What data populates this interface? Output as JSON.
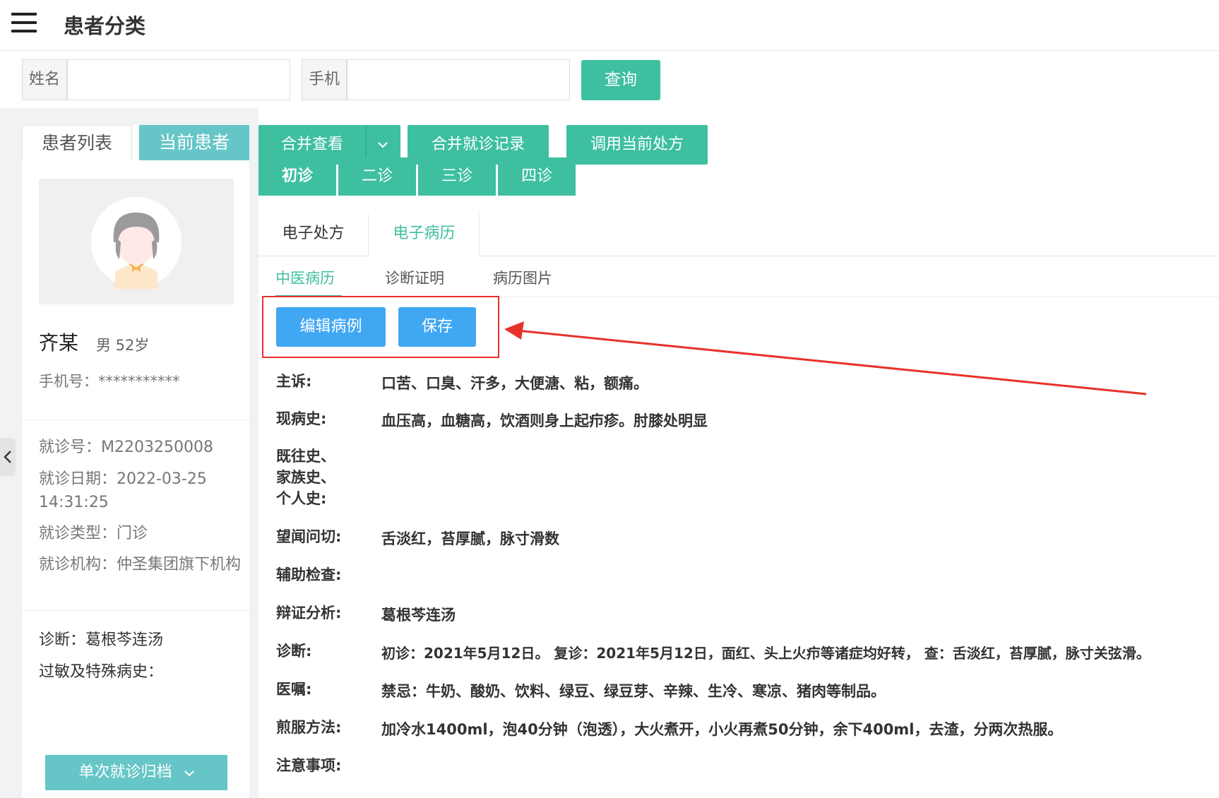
{
  "header": {
    "title": "患者分类"
  },
  "search": {
    "name_label": "姓名",
    "phone_label": "手机",
    "name_value": "",
    "phone_value": "",
    "query_label": "查询"
  },
  "left_tabs": {
    "list": "患者列表",
    "current": "当前患者"
  },
  "patient": {
    "name": "齐某",
    "gender_age": "男 52岁",
    "phone_label": "手机号：",
    "phone_value": "***********",
    "visit_no": "就诊号：M2203250008",
    "visit_date": "就诊日期：2022-03-25 14:31:25",
    "visit_type": "就诊类型：门诊",
    "institution": "就诊机构：仲圣集团旗下机构",
    "diagnosis": "诊断：葛根芩连汤",
    "allergy": "过敏及特殊病史：",
    "archive_button": "单次就诊归档"
  },
  "toolbar": {
    "merge_view": "合并查看",
    "merge_records": "合并就诊记录",
    "use_prescription": "调用当前处方"
  },
  "visits": [
    "初诊",
    "二诊",
    "三诊",
    "四诊"
  ],
  "rx_tabs": [
    "电子处方",
    "电子病历"
  ],
  "sub_tabs": [
    "中医病历",
    "诊断证明",
    "病历图片"
  ],
  "actions": {
    "edit": "编辑病例",
    "save": "保存"
  },
  "record": [
    {
      "label": "主诉:",
      "value": "口苦、口臭、汗多，大便溏、粘，额痛。"
    },
    {
      "label": "现病史:",
      "value": "血压高，血糖高，饮酒则身上起疖疹。肘膝处明显"
    },
    {
      "label": "既往史、\n家族史、\n个人史:",
      "value": ""
    },
    {
      "label": "望闻问切:",
      "value": "舌淡红，苔厚腻，脉寸滑数"
    },
    {
      "label": "辅助检查:",
      "value": ""
    },
    {
      "label": "辩证分析:",
      "value": "葛根芩连汤"
    },
    {
      "label": "诊断:",
      "value": "初诊：2021年5月12日。 复诊：2021年5月12日，面红、头上火疖等诸症均好转， 查：舌淡红，苔厚腻，脉寸关弦滑。"
    },
    {
      "label": "医嘱:",
      "value": "禁忌：牛奶、酸奶、饮料、绿豆、绿豆芽、辛辣、生冷、寒凉、猪肉等制品。"
    },
    {
      "label": "煎服方法:",
      "value": "加冷水1400ml，泡40分钟（泡透），大火煮开，小火再煮50分钟，余下400ml，去渣，分两次热服。"
    },
    {
      "label": "注意事项:",
      "value": ""
    }
  ],
  "colors": {
    "green": "#3dbfa0",
    "teal": "#66c5c7",
    "blue": "#40a7f3",
    "red": "#e8312a"
  }
}
